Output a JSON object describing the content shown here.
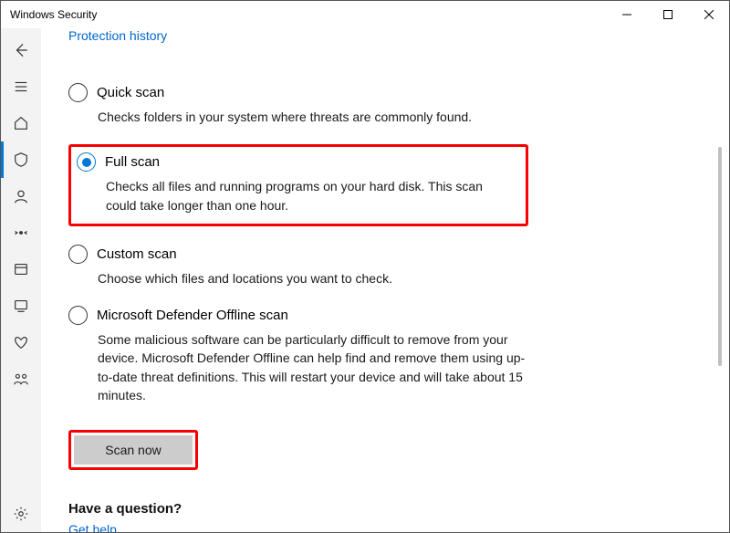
{
  "window": {
    "title": "Windows Security"
  },
  "header_link": "Protection history",
  "options": {
    "quick": {
      "label": "Quick scan",
      "desc": "Checks folders in your system where threats are commonly found."
    },
    "full": {
      "label": "Full scan",
      "desc": "Checks all files and running programs on your hard disk. This scan could take longer than one hour."
    },
    "custom": {
      "label": "Custom scan",
      "desc": "Choose which files and locations you want to check."
    },
    "offline": {
      "label": "Microsoft Defender Offline scan",
      "desc": "Some malicious software can be particularly difficult to remove from your device. Microsoft Defender Offline can help find and remove them using up-to-date threat definitions. This will restart your device and will take about 15 minutes."
    }
  },
  "scan_button": "Scan now",
  "footer": {
    "question": "Have a question?",
    "help_link": "Get help"
  }
}
